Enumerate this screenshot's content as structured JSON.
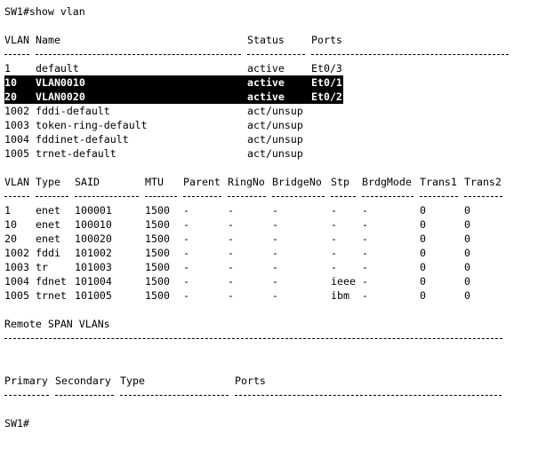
{
  "prompt_command": "SW1#show vlan",
  "vlan_table": {
    "headers": {
      "vlan": "VLAN",
      "name": "Name",
      "status": "Status",
      "ports": "Ports"
    },
    "rows": [
      {
        "vlan": "1",
        "name": "default",
        "status": "active",
        "ports": "Et0/3",
        "highlighted": false
      },
      {
        "vlan": "10",
        "name": "VLAN0010",
        "status": "active",
        "ports": "Et0/1",
        "highlighted": true
      },
      {
        "vlan": "20",
        "name": "VLAN0020",
        "status": "active",
        "ports": "Et0/2",
        "highlighted": true
      },
      {
        "vlan": "1002",
        "name": "fddi-default",
        "status": "act/unsup",
        "ports": "",
        "highlighted": false
      },
      {
        "vlan": "1003",
        "name": "token-ring-default",
        "status": "act/unsup",
        "ports": "",
        "highlighted": false
      },
      {
        "vlan": "1004",
        "name": "fddinet-default",
        "status": "act/unsup",
        "ports": "",
        "highlighted": false
      },
      {
        "vlan": "1005",
        "name": "trnet-default",
        "status": "act/unsup",
        "ports": "",
        "highlighted": false
      }
    ]
  },
  "type_table": {
    "headers": {
      "vlan": "VLAN",
      "type": "Type",
      "said": "SAID",
      "mtu": "MTU",
      "parent": "Parent",
      "ringno": "RingNo",
      "bridgeno": "BridgeNo",
      "stp": "Stp",
      "brdgmode": "BrdgMode",
      "trans1": "Trans1",
      "trans2": "Trans2"
    },
    "rows": [
      {
        "vlan": "1",
        "type": "enet",
        "said": "100001",
        "mtu": "1500",
        "parent": "-",
        "ringno": "-",
        "bridgeno": "-",
        "stp": "-",
        "brdgmode": "-",
        "trans1": "0",
        "trans2": "0"
      },
      {
        "vlan": "10",
        "type": "enet",
        "said": "100010",
        "mtu": "1500",
        "parent": "-",
        "ringno": "-",
        "bridgeno": "-",
        "stp": "-",
        "brdgmode": "-",
        "trans1": "0",
        "trans2": "0"
      },
      {
        "vlan": "20",
        "type": "enet",
        "said": "100020",
        "mtu": "1500",
        "parent": "-",
        "ringno": "-",
        "bridgeno": "-",
        "stp": "-",
        "brdgmode": "-",
        "trans1": "0",
        "trans2": "0"
      },
      {
        "vlan": "1002",
        "type": "fddi",
        "said": "101002",
        "mtu": "1500",
        "parent": "-",
        "ringno": "-",
        "bridgeno": "-",
        "stp": "-",
        "brdgmode": "-",
        "trans1": "0",
        "trans2": "0"
      },
      {
        "vlan": "1003",
        "type": "tr",
        "said": "101003",
        "mtu": "1500",
        "parent": "-",
        "ringno": "-",
        "bridgeno": "-",
        "stp": "-",
        "brdgmode": "-",
        "trans1": "0",
        "trans2": "0"
      },
      {
        "vlan": "1004",
        "type": "fdnet",
        "said": "101004",
        "mtu": "1500",
        "parent": "-",
        "ringno": "-",
        "bridgeno": "-",
        "stp": "ieee",
        "brdgmode": "-",
        "trans1": "0",
        "trans2": "0"
      },
      {
        "vlan": "1005",
        "type": "trnet",
        "said": "101005",
        "mtu": "1500",
        "parent": "-",
        "ringno": "-",
        "bridgeno": "-",
        "stp": "ibm",
        "brdgmode": "-",
        "trans1": "0",
        "trans2": "0"
      }
    ]
  },
  "remote_span": {
    "title": "Remote SPAN VLANs"
  },
  "private_vlan": {
    "headers": {
      "primary": "Primary",
      "secondary": "Secondary",
      "type": "Type",
      "ports": "Ports"
    }
  },
  "final_prompt": "SW1#"
}
